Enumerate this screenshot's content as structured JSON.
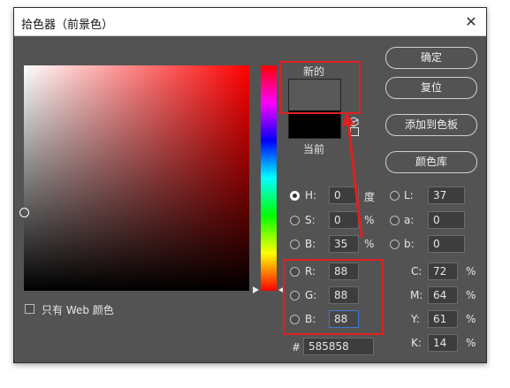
{
  "dialog": {
    "title": "拾色器（前景色）",
    "close_symbol": "✕"
  },
  "buttons": {
    "ok": "确定",
    "reset": "复位",
    "add_to_swatches": "添加到色板",
    "color_libraries": "颜色库"
  },
  "preview": {
    "new_label": "新的",
    "current_label": "当前",
    "new_color": "#585858",
    "current_color": "#000000"
  },
  "hsb": {
    "h": {
      "label": "H:",
      "value": "0",
      "unit": "度"
    },
    "s": {
      "label": "S:",
      "value": "0",
      "unit": "%"
    },
    "b": {
      "label": "B:",
      "value": "35",
      "unit": "%"
    }
  },
  "lab": {
    "l": {
      "label": "L:",
      "value": "37"
    },
    "a": {
      "label": "a:",
      "value": "0"
    },
    "b": {
      "label": "b:",
      "value": "0"
    }
  },
  "rgb": {
    "r": {
      "label": "R:",
      "value": "88"
    },
    "g": {
      "label": "G:",
      "value": "88"
    },
    "b": {
      "label": "B:",
      "value": "88"
    }
  },
  "cmyk": {
    "c": {
      "label": "C:",
      "value": "72",
      "unit": "%"
    },
    "m": {
      "label": "M:",
      "value": "64",
      "unit": "%"
    },
    "y": {
      "label": "Y:",
      "value": "61",
      "unit": "%"
    },
    "k": {
      "label": "K:",
      "value": "14",
      "unit": "%"
    }
  },
  "hex": {
    "label": "#",
    "value": "585858"
  },
  "web_only": {
    "label": "只有 Web 颜色",
    "checked": false
  },
  "colors": {
    "hue": "#ff0000",
    "annotation": "#e02020",
    "focus": "#3d7ad6"
  },
  "icons": [
    "close-icon",
    "gamut-warning-cube-icon",
    "web-safe-square-icon",
    "hue-slider-arrow-icon",
    "color-field-ring-icon"
  ]
}
